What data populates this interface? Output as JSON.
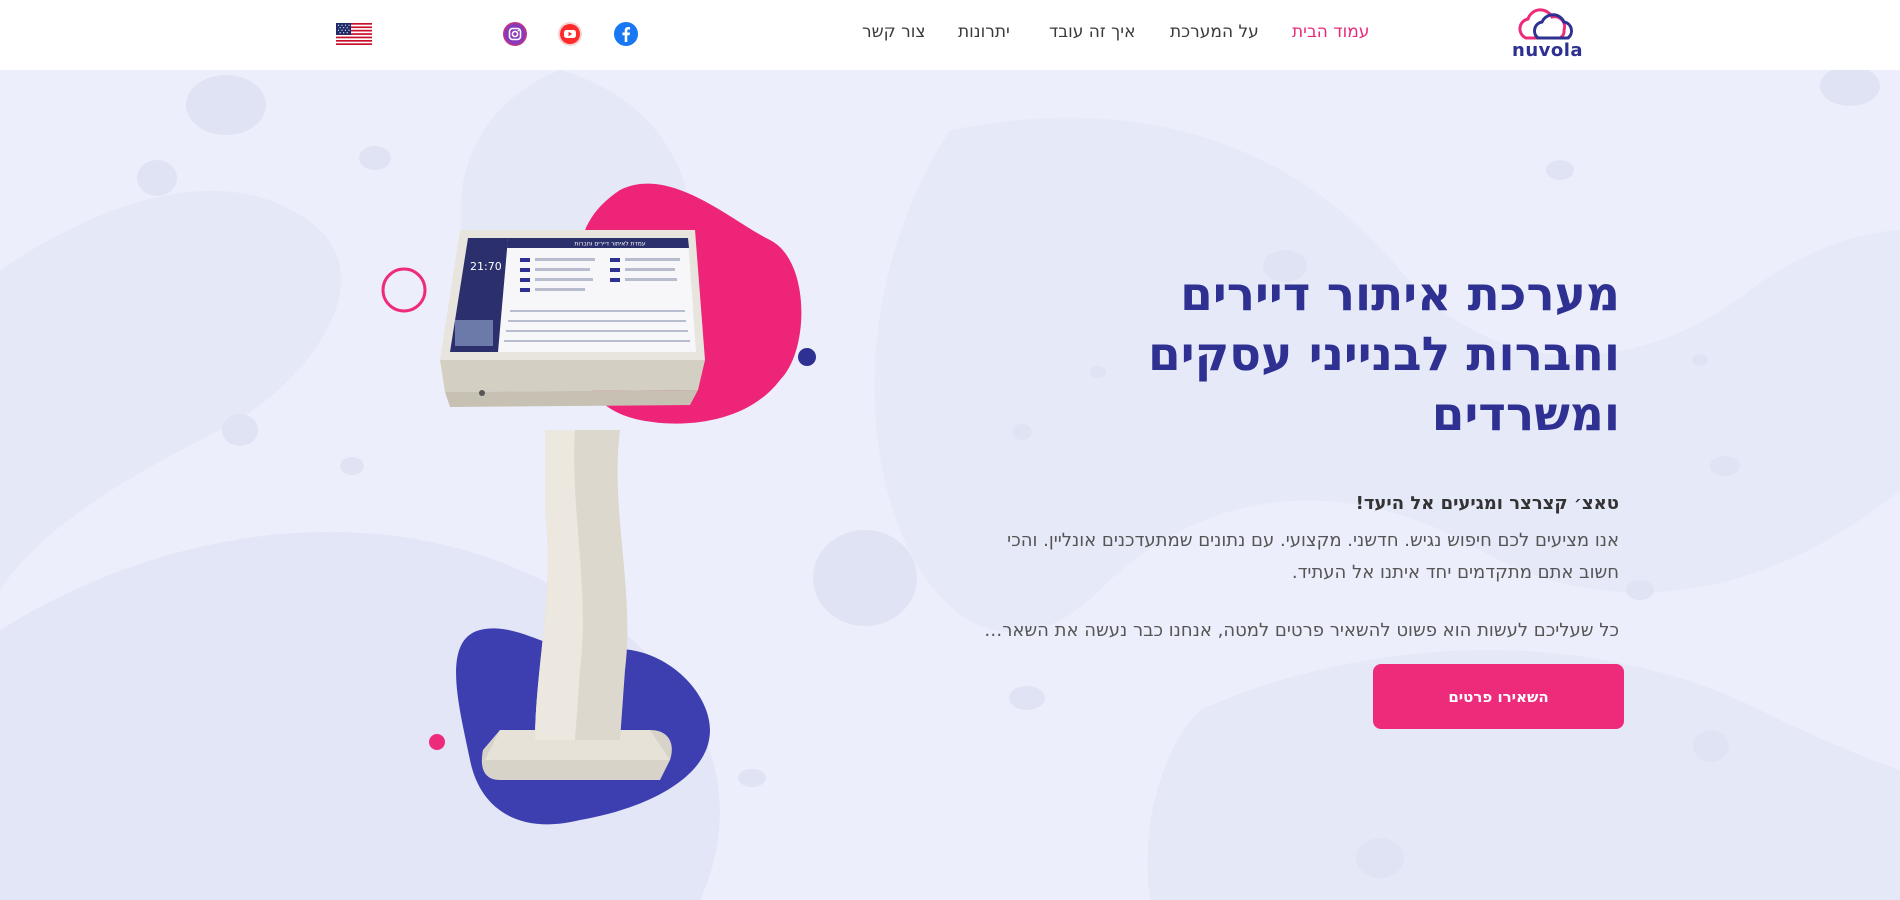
{
  "header": {
    "logo_text": "nuvola",
    "nav": [
      {
        "label": "עמוד הבית",
        "active": true
      },
      {
        "label": "על המערכת",
        "active": false
      },
      {
        "label": "איך זה עובד",
        "active": false
      },
      {
        "label": "יתרונות",
        "active": false
      },
      {
        "label": "צור קשר",
        "active": false
      }
    ],
    "social": [
      {
        "icon": "facebook-icon",
        "color": "#1877f2"
      },
      {
        "icon": "youtube-icon",
        "color": "#ff0000"
      },
      {
        "icon": "instagram-icon",
        "color": "#c13584"
      }
    ],
    "language_icon": "us-flag-icon"
  },
  "hero": {
    "headline": [
      "מערכת איתור דיירים",
      "וחברות לבנייני עסקים",
      "ומשרדים"
    ],
    "lead_bold": "טאצ׳ קצרצר ומגיעים אל היעד!",
    "lead_body": [
      "אנו מציעים לכם חיפוש נגיש. חדשני. מקצועי. עם נתונים שמתעדכנים אונליין. והכי",
      "חשוב אתם מתקדמים יחד איתנו אל העתיד."
    ],
    "lead_extra": "כל שעליכם לעשות הוא פשוט להשאיר פרטים למטה, אנחנו כבר נעשה את השאר…",
    "cta_label": "השאירו פרטים",
    "kiosk_screen_title": "עמדת לאיתור דיירים וחברות",
    "kiosk_time": "21:70"
  },
  "colors": {
    "brand_navy": "#2e3192",
    "brand_pink": "#ee2b7b",
    "background": "#eceffb"
  }
}
